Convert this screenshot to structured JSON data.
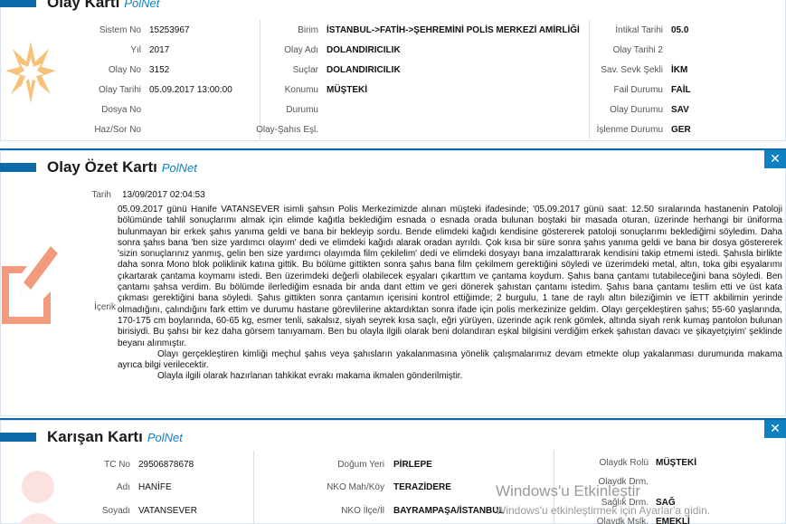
{
  "colors": {
    "accent": "#0d6aa8",
    "brand": "#0f80c2",
    "icon_olay": "#f6c27a",
    "icon_ozet": "#f19b7c"
  },
  "olay_karti": {
    "title": "Olay Kartı",
    "brand": "PolNet",
    "icon": "star-burst-icon",
    "col1": [
      {
        "label": "Sistem No",
        "value": "15253967"
      },
      {
        "label": "Yıl",
        "value": "2017"
      },
      {
        "label": "Olay No",
        "value": "3152"
      },
      {
        "label": "Olay Tarihi",
        "value": "05.09.2017 13:00:00"
      },
      {
        "label": "Dosya No",
        "value": ""
      },
      {
        "label": "Haz/Sor No",
        "value": ""
      }
    ],
    "col2": [
      {
        "label": "Birim",
        "value": "İSTANBUL->FATİH->ŞEHREMİNİ POLİS MERKEZİ AMİRLİĞİ"
      },
      {
        "label": "Olay Adı",
        "value": "DOLANDIRICILIK"
      },
      {
        "label": "Suçlar",
        "value": "DOLANDIRICILIK"
      },
      {
        "label": "Konumu",
        "value": "MÜŞTEKİ"
      },
      {
        "label": "Durumu",
        "value": ""
      },
      {
        "label": "Olay-Şahıs Eşl.",
        "value": ""
      }
    ],
    "col3": [
      {
        "label": "İntikal Tarihi",
        "value": "05.0"
      },
      {
        "label": "Olay Tarihi 2",
        "value": ""
      },
      {
        "label": "Sav. Sevk Şekli",
        "value": "İKM"
      },
      {
        "label": "Fail Durumu",
        "value": "FAİL"
      },
      {
        "label": "Olay Durumu",
        "value": "SAV"
      },
      {
        "label": "İşlenme Durumu",
        "value": "GER"
      }
    ]
  },
  "olay_ozet_karti": {
    "title": "Olay Özet Kartı",
    "brand": "PolNet",
    "icon": "edit-note-icon",
    "close": "✕",
    "tarih_label": "Tarih",
    "tarih_value": "13/09/2017 02:04:53",
    "icerik_label": "İçerik",
    "paragraphs": [
      "05.09.2017 günü Hanife VATANSEVER isimli şahsın Polis Merkezimizde alınan müşteki ifadesinde; '05.09.2017 günü saat: 12.50 sıralarında hastanenin Patoloji bölümünde tahlil sonuçlarımı almak için elimde kağıtla beklediğim esnada o esnada orada bulunan boştaki bir masada oturan, üzerinde herhangi bir üniforma bulunmayan bir erkek şahıs yanıma geldi ve bana bir bekleyip sordu. Bende elimdeki kağıdı kendisine göstererek patoloji sonuçlarımı beklediğimi söyledim. Daha sonra şahıs bana 'ben size yardımcı olayım' dedi ve elimdeki kağıdı alarak oradan ayrıldı. Çok kısa bir süre sonra şahıs yanıma geldi ve bana bir dosya göstererek 'sizin sonuçlarınız yanmış, gelin ben size yardımcı olayımda film çekilelim' dedi ve elimdeki dosyayı bana imzalattırarak kendisini takip etmemi istedi. Şahısla birlikte daha sonra Mono blok poliklinik katına gittik. Bu bölüme gittikten sonra şahıs bana film çekilmem gerektiğini söyledi ve üzerimdeki metal, altın, toka gibi eşyalarımı çıkartarak çantama koymamı istedi. Ben üzerimdeki değerli olabilecek eşyaları çıkarttım ve çantama koydum. Şahıs bana çantamı tutabileceğini bana söyledi. Ben çantamı şahsa verdim. Bu bölümde ilerlediğim esnada bir anda dant ettim ve geri dönerek şahıstan çantamı istedim. Şahıs bana çantamı teslim etti ve üst kata çıkması gerektiğini bana söyledi. Şahıs gittikten sonra çantamın içerisini kontrol ettiğimde; 2 burgulu, 1 tane de raylı altın bileziğimin ve İETT akbilimin yerinde olmadığını, çalındığını fark ettim ve durumu hastane görevlilerine aktardıktan sonra ifade için polis merkezinize geldim. Olayı gerçekleştiren şahıs; 55-60 yaşlarında, 170-175 cm boylarında, 60-65 kg, esmer tenli, sakalsız, siyah seyrek kısa saçlı, eğri yürüyen, üzerinde açık renk gömlek, altında siyah renk kumaş pantolon bulunan birisiydi. Bu şahsı bir kez daha görsem tanıyamam. Ben bu olayla ilgili olarak beni dolandıran eşkal bilgisini verdiğim erkek şahıstan davacı ve şikayetçiyim' şeklinde beyanı alınmıştır.",
      "Olayı gerçekleştiren kimliği meçhul şahıs veya şahısların yakalanmasına yönelik çalışmalarımız devam etmekte olup yakalanması durumunda makama ayrıca bilgi verilecektir.",
      "Olayla ilgili olarak hazırlanan tahkikat evrakı makama ikmalen gönderilmiştir."
    ]
  },
  "karisan_karti": {
    "title": "Karışan Kartı",
    "brand": "PolNet",
    "icon": "person-icon",
    "close": "✕",
    "col1": [
      {
        "label": "TC No",
        "value": "29506878678"
      },
      {
        "label": "Adı",
        "value": "HANİFE"
      },
      {
        "label": "Soyadı",
        "value": "VATANSEVER"
      }
    ],
    "col2": [
      {
        "label": "Doğum Yeri",
        "value": "PİRLEPE"
      },
      {
        "label": "NKO Mah/Köy",
        "value": "TERAZİDERE"
      },
      {
        "label": "NKO İlçe/İl",
        "value": "BAYRAMPAŞA/İSTANBUL"
      }
    ],
    "col3": [
      {
        "label": "Olaydk Rolü",
        "value": "MÜŞTEKİ"
      },
      {
        "label": "Olaydk Drm.",
        "value": ""
      },
      {
        "label": "Sağlık Drm.",
        "value": "SAĞ"
      },
      {
        "label": "Olaydk Mslk.",
        "value": "EMEKLİ"
      }
    ]
  },
  "watermark": {
    "line1": "Windows'u Etkinleştir",
    "line2": "Windows'u etkinleştirmek için Ayarlar'a gidin."
  }
}
